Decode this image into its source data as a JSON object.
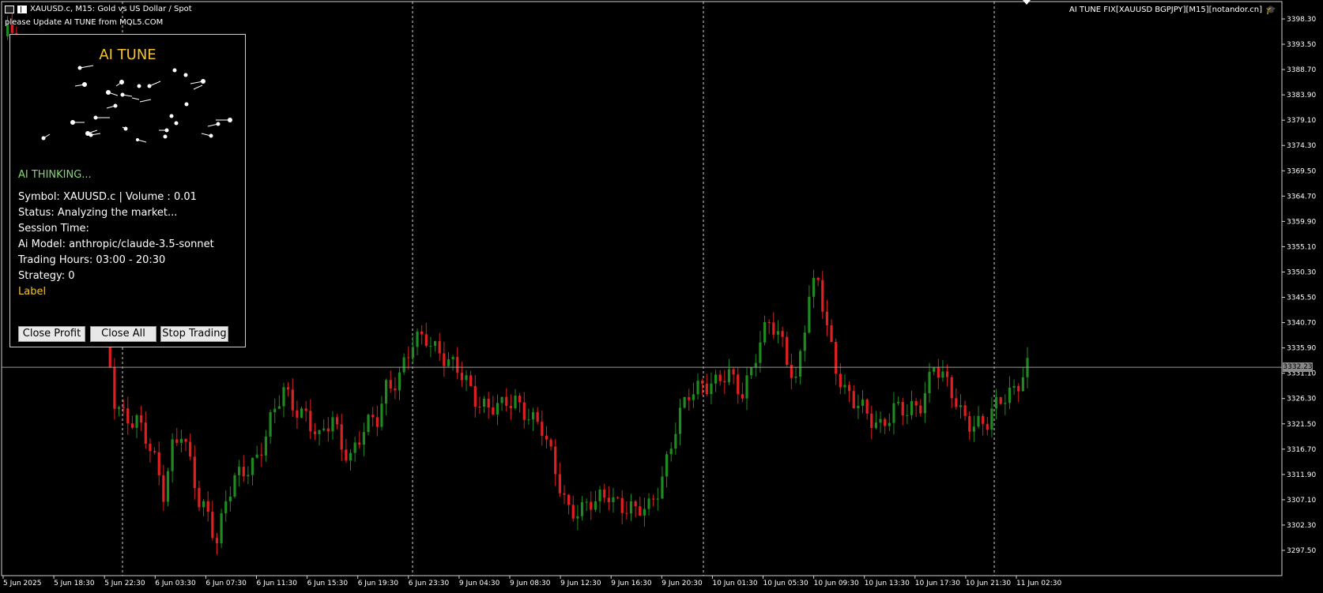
{
  "header": {
    "symbol_title": "XAUUSD.c, M15:  Gold vs US Dollar / Spot",
    "update_message": "please Update AI TUNE from MQL5.COM",
    "right_label": "AI TUNE FIX[XAUUSD BGPJPY][M15][notandor.cn]"
  },
  "panel": {
    "title": "AI TUNE",
    "thinking": "AI THINKING...",
    "symbol_line": "Symbol: XAUUSD.c | Volume : 0.01",
    "status_line": "Status: Analyzing the market...",
    "session_line": "Session Time:",
    "model_line": "Ai Model: anthropic/claude-3.5-sonnet",
    "hours_line": "Trading Hours: 03:00 - 20:30",
    "strategy_line": "Strategy: 0",
    "label_line": "Label",
    "buttons": {
      "close_profit": "Close Profit",
      "close_all": "Close All",
      "stop_trading": "Stop Trading"
    }
  },
  "colors": {
    "bull": "#1f8a1f",
    "bear": "#e02020",
    "accent": "#f2c230",
    "thinking": "#7fdc6a"
  },
  "chart_data": {
    "type": "candlestick",
    "price_axis": {
      "labels": [
        "3398.30",
        "3393.50",
        "3388.70",
        "3383.90",
        "3379.10",
        "3374.30",
        "3369.50",
        "3364.70",
        "3359.90",
        "3355.10",
        "3350.30",
        "3345.50",
        "3340.70",
        "3335.90",
        "3331.10",
        "3326.30",
        "3321.50",
        "3316.70",
        "3311.90",
        "3307.10",
        "3302.30",
        "3297.50"
      ],
      "ylim": [
        3295.0,
        3400.0
      ]
    },
    "time_axis": {
      "labels": [
        "5 Jun 2025",
        "5 Jun 18:30",
        "5 Jun 22:30",
        "6 Jun 03:30",
        "6 Jun 07:30",
        "6 Jun 11:30",
        "6 Jun 15:30",
        "6 Jun 19:30",
        "6 Jun 23:30",
        "9 Jun 04:30",
        "9 Jun 08:30",
        "9 Jun 12:30",
        "9 Jun 16:30",
        "9 Jun 20:30",
        "10 Jun 01:30",
        "10 Jun 05:30",
        "10 Jun 09:30",
        "10 Jun 13:30",
        "10 Jun 17:30",
        "10 Jun 21:30",
        "11 Jun 02:30"
      ]
    },
    "current_price": "3332.23",
    "close_path": [
      [
        3395,
        2
      ],
      [
        3380,
        6
      ],
      [
        3366,
        9
      ],
      [
        3360,
        12
      ],
      [
        3363,
        15
      ],
      [
        3362,
        18
      ],
      [
        3356,
        20
      ],
      [
        3347,
        22
      ],
      [
        3337,
        23
      ],
      [
        3326,
        25
      ],
      [
        3324,
        27
      ],
      [
        3322,
        30
      ],
      [
        3318,
        32
      ],
      [
        3314,
        34
      ],
      [
        3309,
        36
      ],
      [
        3318,
        38
      ],
      [
        3320,
        40
      ],
      [
        3313,
        42
      ],
      [
        3306,
        44
      ],
      [
        3305,
        46
      ],
      [
        3300,
        48
      ],
      [
        3307,
        50
      ],
      [
        3310,
        52
      ],
      [
        3313,
        55
      ],
      [
        3316,
        57
      ],
      [
        3322,
        60
      ],
      [
        3327,
        63
      ],
      [
        3325,
        65
      ],
      [
        3324,
        68
      ],
      [
        3318,
        71
      ],
      [
        3322,
        74
      ],
      [
        3318,
        76
      ],
      [
        3316,
        78
      ],
      [
        3320,
        81
      ],
      [
        3322,
        84
      ],
      [
        3329,
        86
      ],
      [
        3331,
        89
      ],
      [
        3336,
        92
      ],
      [
        3338,
        95
      ],
      [
        3336,
        98
      ],
      [
        3333,
        100
      ],
      [
        3330,
        103
      ],
      [
        3327,
        106
      ],
      [
        3325,
        109
      ],
      [
        3324,
        112
      ],
      [
        3326,
        115
      ],
      [
        3324,
        118
      ],
      [
        3320,
        121
      ],
      [
        3312,
        124
      ],
      [
        3306,
        127
      ],
      [
        3305,
        130
      ],
      [
        3306,
        133
      ],
      [
        3309,
        136
      ],
      [
        3306,
        139
      ],
      [
        3304,
        142
      ],
      [
        3306,
        145
      ],
      [
        3312,
        148
      ],
      [
        3320,
        151
      ],
      [
        3327,
        154
      ],
      [
        3330,
        157
      ],
      [
        3329,
        160
      ],
      [
        3330,
        163
      ],
      [
        3328,
        166
      ],
      [
        3335,
        169
      ],
      [
        3340,
        172
      ],
      [
        3337,
        175
      ],
      [
        3330,
        178
      ],
      [
        3345,
        181
      ],
      [
        3348,
        183
      ],
      [
        3340,
        185
      ],
      [
        3333,
        187
      ],
      [
        3328,
        189
      ],
      [
        3325,
        191
      ],
      [
        3323,
        194
      ],
      [
        3322,
        197
      ],
      [
        3324,
        200
      ],
      [
        3323,
        203
      ],
      [
        3326,
        206
      ],
      [
        3333,
        209
      ],
      [
        3328,
        212
      ],
      [
        3324,
        215
      ],
      [
        3322,
        218
      ],
      [
        3321,
        221
      ],
      [
        3326,
        224
      ],
      [
        3329,
        227
      ],
      [
        3332,
        230
      ]
    ]
  }
}
